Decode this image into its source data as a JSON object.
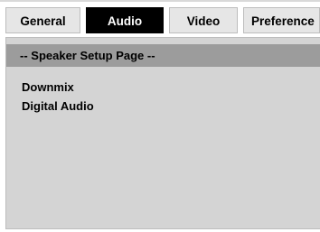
{
  "tabs": [
    {
      "label": "General",
      "active": false
    },
    {
      "label": "Audio",
      "active": true
    },
    {
      "label": "Video",
      "active": false
    },
    {
      "label": "Preference",
      "active": false
    }
  ],
  "page": {
    "header": "-- Speaker Setup Page --",
    "options": [
      {
        "label": "Downmix"
      },
      {
        "label": "Digital Audio"
      }
    ]
  },
  "colors": {
    "active_tab_bg": "#000000",
    "active_tab_text": "#ffffff",
    "tab_bg": "#e6e6e6",
    "panel_bg": "#d4d4d4",
    "header_bg": "#9c9c9c"
  }
}
